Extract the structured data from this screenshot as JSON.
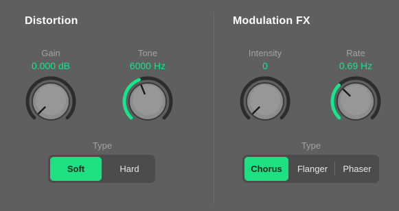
{
  "colors": {
    "background": "#5f5f5f",
    "accent": "#17e58b",
    "knob_track": "#2c2c2c",
    "knob_body": "#8a8a8a",
    "segment_bg": "#4c4c4c"
  },
  "distortion": {
    "title": "Distortion",
    "gain": {
      "label": "Gain",
      "value": "0.000 dB",
      "fill": 0.0
    },
    "tone": {
      "label": "Tone",
      "value": "6000 Hz",
      "fill": 0.42
    },
    "type_label": "Type",
    "type_options": [
      "Soft",
      "Hard"
    ],
    "type_selected": "Soft"
  },
  "modulation": {
    "title": "Modulation FX",
    "intensity": {
      "label": "Intensity",
      "value": "0",
      "fill": 0.0
    },
    "rate": {
      "label": "Rate",
      "value": "0.69 Hz",
      "fill": 0.33
    },
    "type_label": "Type",
    "type_options": [
      "Chorus",
      "Flanger",
      "Phaser"
    ],
    "type_selected": "Chorus"
  }
}
